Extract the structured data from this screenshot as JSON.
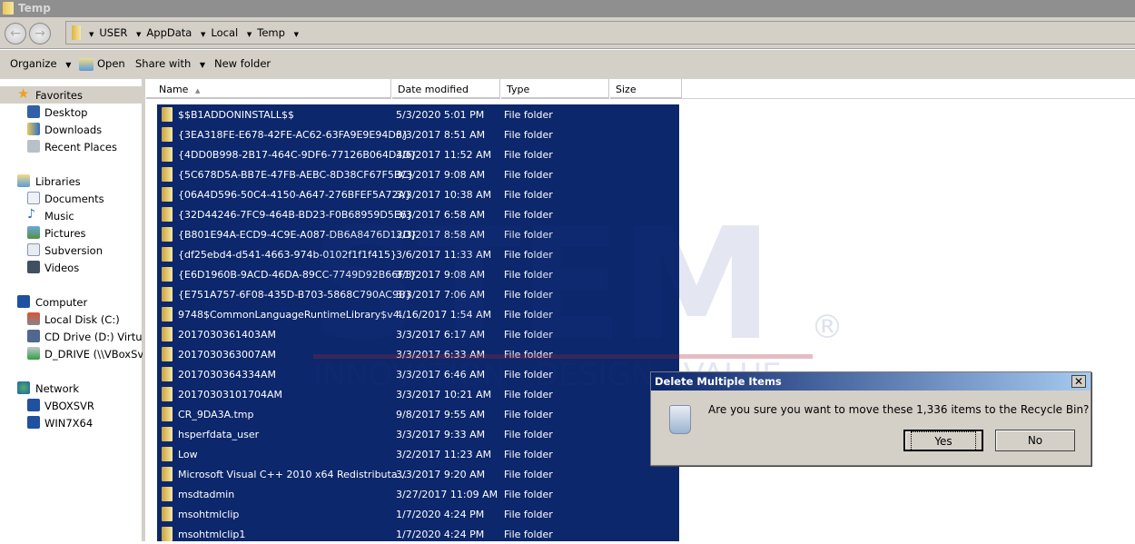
{
  "window": {
    "title": "Temp"
  },
  "breadcrumb": [
    "USER",
    "AppData",
    "Local",
    "Temp"
  ],
  "toolbar": {
    "organize": "Organize",
    "open": "Open",
    "share_with": "Share with",
    "new_folder": "New folder"
  },
  "nav": {
    "favorites": "Favorites",
    "desktop": "Desktop",
    "downloads": "Downloads",
    "recent": "Recent Places",
    "libraries": "Libraries",
    "documents": "Documents",
    "music": "Music",
    "pictures": "Pictures",
    "subversion": "Subversion",
    "videos": "Videos",
    "computer": "Computer",
    "local_disk": "Local Disk (C:)",
    "cd_drive": "CD Drive (D:) VirtualBox",
    "d_drive": "D_DRIVE (\\\\VBoxSvr) (E:)",
    "network": "Network",
    "vboxsvr": "VBOXSVR",
    "win7x64": "WIN7X64"
  },
  "columns": {
    "name": "Name",
    "date": "Date modified",
    "type": "Type",
    "size": "Size"
  },
  "files": [
    {
      "name": "$$B1ADDONINSTALL$$",
      "date": "5/3/2020 5:01 PM",
      "type": "File folder"
    },
    {
      "name": "{3EA318FE-E678-42FE-AC62-63FA9E9E94D6}",
      "date": "3/3/2017 8:51 AM",
      "type": "File folder"
    },
    {
      "name": "{4DD0B998-2B17-464C-9DF6-77126B064D4D}",
      "date": "3/6/2017 11:52 AM",
      "type": "File folder"
    },
    {
      "name": "{5C678D5A-BB7E-47FB-AEBC-8D38CF67F5BC}",
      "date": "3/3/2017 9:08 AM",
      "type": "File folder"
    },
    {
      "name": "{06A4D596-50C4-4150-A647-276BFEF5A72A}",
      "date": "3/3/2017 10:38 AM",
      "type": "File folder"
    },
    {
      "name": "{32D44246-7FC9-464B-BD23-F0B68959D5E6}",
      "date": "3/3/2017 6:58 AM",
      "type": "File folder"
    },
    {
      "name": "{B801E94A-ECD9-4C9E-A087-DB6A8476D12D}",
      "date": "3/3/2017 8:58 AM",
      "type": "File folder"
    },
    {
      "name": "{df25ebd4-d541-4663-974b-0102f1f1f415}",
      "date": "3/6/2017 11:33 AM",
      "type": "File folder"
    },
    {
      "name": "{E6D1960B-9ACD-46DA-89CC-7749D92B66F1}",
      "date": "3/3/2017 9:08 AM",
      "type": "File folder"
    },
    {
      "name": "{E751A757-6F08-435D-B703-5868C790AC9B}",
      "date": "3/3/2017 7:06 AM",
      "type": "File folder"
    },
    {
      "name": "9748$CommonLanguageRuntimeLibrary$v4....",
      "date": "4/16/2017 1:54 AM",
      "type": "File folder"
    },
    {
      "name": "2017030361403AM",
      "date": "3/3/2017 6:17 AM",
      "type": "File folder"
    },
    {
      "name": "2017030363007AM",
      "date": "3/3/2017 6:33 AM",
      "type": "File folder"
    },
    {
      "name": "2017030364334AM",
      "date": "3/3/2017 6:46 AM",
      "type": "File folder"
    },
    {
      "name": "20170303101704AM",
      "date": "3/3/2017 10:21 AM",
      "type": "File folder"
    },
    {
      "name": "CR_9DA3A.tmp",
      "date": "9/8/2017 9:55 AM",
      "type": "File folder"
    },
    {
      "name": "hsperfdata_user",
      "date": "3/3/2017 9:33 AM",
      "type": "File folder"
    },
    {
      "name": "Low",
      "date": "3/2/2017 11:23 AM",
      "type": "File folder"
    },
    {
      "name": "Microsoft Visual C++ 2010  x64 Redistributa...",
      "date": "3/3/2017 9:20 AM",
      "type": "File folder"
    },
    {
      "name": "msdtadmin",
      "date": "3/27/2017 11:09 AM",
      "type": "File folder"
    },
    {
      "name": "msohtmlclip",
      "date": "1/7/2020 4:24 PM",
      "type": "File folder"
    },
    {
      "name": "msohtmlclip1",
      "date": "1/7/2020 4:24 PM",
      "type": "File folder"
    }
  ],
  "watermark": {
    "logo": "STEM",
    "tagline": "INNOVATION  DESIGN  VALUE",
    "mark": "®"
  },
  "dialog": {
    "title": "Delete Multiple Items",
    "message": "Are you sure you want to move these 1,336 items to the Recycle Bin?",
    "yes": "Yes",
    "no": "No",
    "close": "✕"
  },
  "colors": {
    "selection": "#0c276b",
    "chrome": "#d4d0c8"
  }
}
